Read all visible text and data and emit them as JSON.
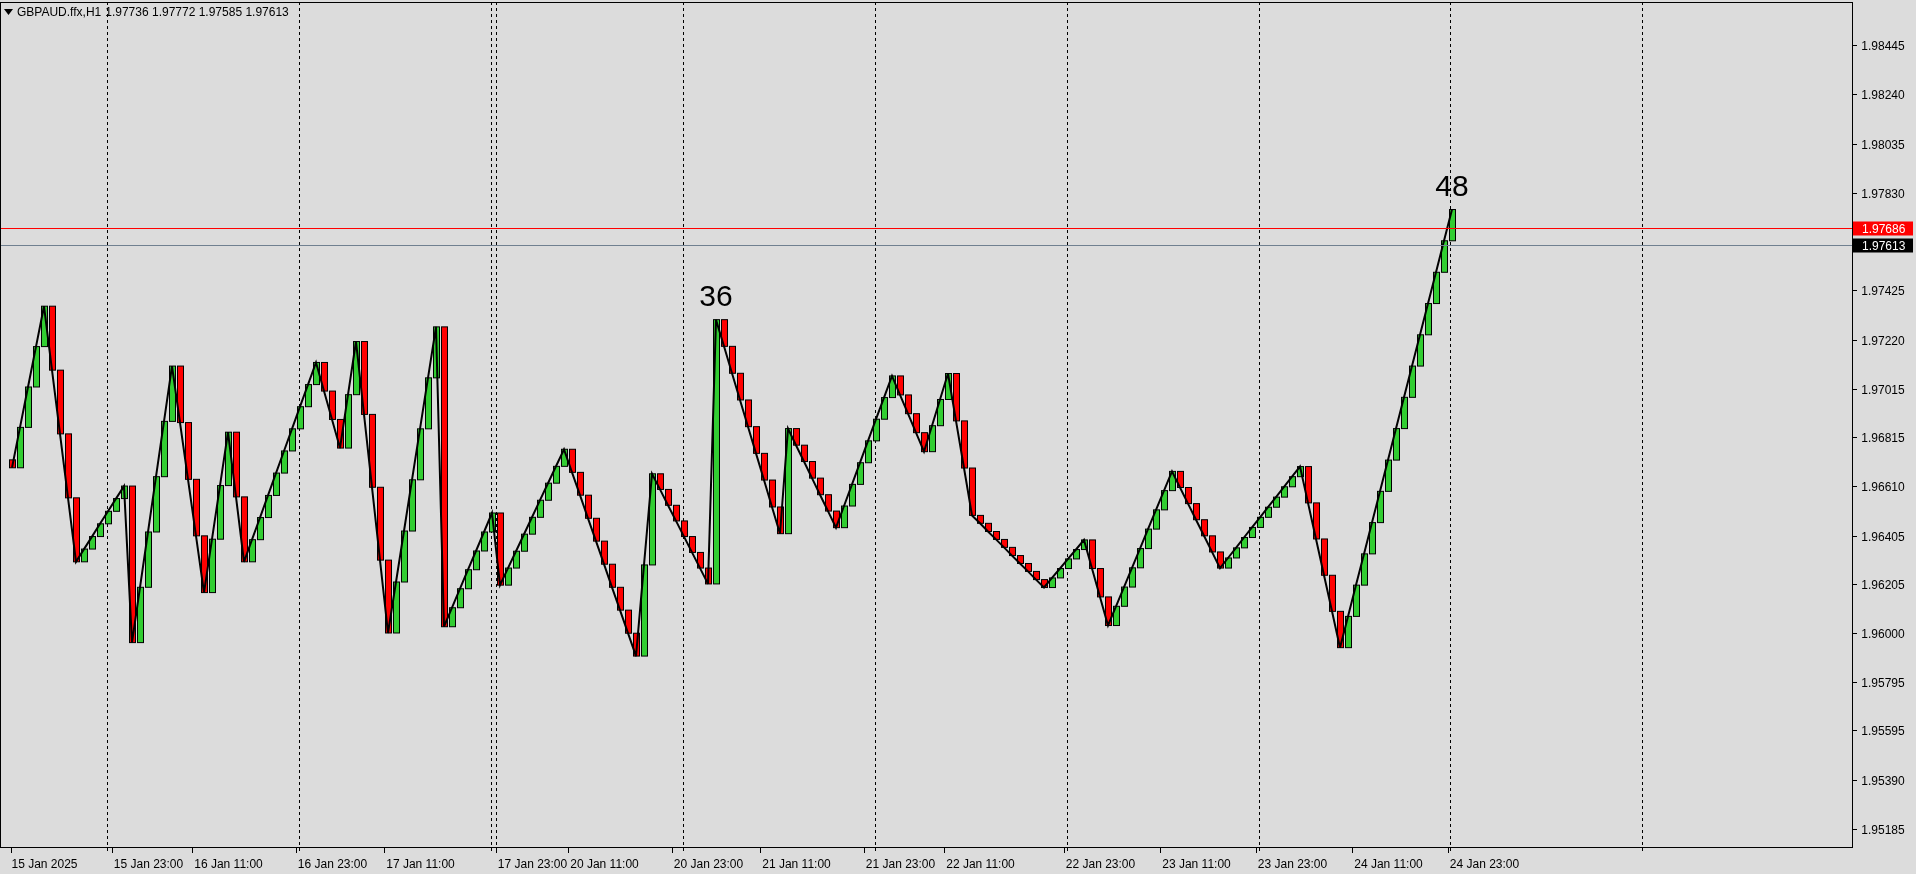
{
  "chart": {
    "symbol": "GBPAUD.ffx,H1",
    "ohlc": "1.97736 1.97772 1.97585 1.97613",
    "chart_data": {
      "type": "candlestick",
      "ylim": [
        1.9511,
        1.98624
      ],
      "categories": [
        null,
        null,
        null,
        null,
        null,
        "15 Jan 2025",
        null,
        null,
        null,
        null,
        null,
        null,
        null,
        null,
        null,
        null,
        null,
        null,
        "15 Jan 23:00",
        null,
        null,
        null,
        null,
        null,
        null,
        null,
        null,
        null,
        "16 Jan 11:00",
        null,
        null,
        null,
        null,
        null,
        null,
        null,
        null,
        null,
        null,
        null,
        null,
        "16 Jan 23:00",
        null,
        null,
        null,
        null,
        null,
        null,
        null,
        null,
        null,
        null,
        "17 Jan 11:00",
        null,
        null,
        null,
        null,
        null,
        null,
        null,
        null,
        null,
        null,
        null,
        null,
        null,
        "17 Jan 23:00",
        null,
        null,
        null,
        null,
        null,
        null,
        null,
        null,
        "20 Jan 11:00",
        null,
        null,
        null,
        null,
        null,
        null,
        null,
        null,
        null,
        null,
        null,
        null,
        "20 Jan 23:00",
        null,
        null,
        null,
        null,
        null,
        null,
        null,
        null,
        null,
        null,
        "21 Jan 11:00",
        null,
        null,
        null,
        null,
        null,
        null,
        null,
        null,
        null,
        null,
        null,
        null,
        "21 Jan 23:00",
        null,
        null,
        null,
        null,
        null,
        null,
        null,
        null,
        null,
        "22 Jan 11:00",
        null,
        null,
        null,
        null,
        null,
        null,
        null,
        null,
        null,
        null,
        null,
        null,
        null,
        null,
        "22 Jan 23:00",
        null,
        null,
        null,
        null,
        null,
        null,
        null,
        null,
        null,
        null,
        null,
        "23 Jan 11:00",
        null,
        null,
        null,
        null,
        null,
        null,
        null,
        null,
        null,
        null,
        null,
        "23 Jan 23:00",
        null,
        null,
        null,
        null,
        null,
        null,
        null,
        null,
        null,
        null,
        null,
        "24 Jan 11:00",
        null,
        null,
        null,
        null,
        null,
        null,
        null,
        null,
        null,
        null,
        null,
        "24 Jan 23:00"
      ],
      "ohlc": [
        null,
        [
          1.9672,
          1.9672,
          1.96687,
          1.96687
        ],
        [
          1.96687,
          1.96855,
          1.96687,
          1.96855
        ],
        [
          1.96855,
          1.97023,
          1.96855,
          1.97023
        ],
        [
          1.97023,
          1.97191,
          1.97023,
          1.97191
        ],
        [
          1.97191,
          1.97359,
          1.97191,
          1.97359
        ],
        [
          1.97359,
          1.97359,
          1.97093,
          1.97093
        ],
        [
          1.97093,
          1.97093,
          1.96828,
          1.96828
        ],
        [
          1.96828,
          1.96828,
          1.96562,
          1.96562
        ],
        [
          1.96562,
          1.96562,
          1.96296,
          1.96296
        ],
        [
          1.96296,
          1.96349,
          1.96296,
          1.96349
        ],
        [
          1.96349,
          1.96401,
          1.96349,
          1.96401
        ],
        [
          1.96401,
          1.96454,
          1.96401,
          1.96454
        ],
        [
          1.96454,
          1.96506,
          1.96454,
          1.96506
        ],
        [
          1.96506,
          1.96559,
          1.96506,
          1.96559
        ],
        [
          1.96559,
          1.96611,
          1.96559,
          1.96611
        ],
        [
          1.96611,
          1.96611,
          1.9596,
          1.9596
        ],
        [
          1.9596,
          1.9619,
          1.9596,
          1.9619
        ],
        [
          1.9619,
          1.9642,
          1.9619,
          1.9642
        ],
        [
          1.9642,
          1.9665,
          1.9642,
          1.9665
        ],
        [
          1.9665,
          1.9688,
          1.9665,
          1.9688
        ],
        [
          1.9688,
          1.9711,
          1.9688,
          1.9711
        ],
        [
          1.9711,
          1.9711,
          1.96875,
          1.96875
        ],
        [
          1.96875,
          1.96875,
          1.96639,
          1.96639
        ],
        [
          1.96639,
          1.96639,
          1.96404,
          1.96404
        ],
        [
          1.96404,
          1.96404,
          1.96168,
          1.96168
        ],
        [
          1.96168,
          1.9639,
          1.96168,
          1.9639
        ],
        [
          1.9639,
          1.96613,
          1.9639,
          1.96613
        ],
        [
          1.96613,
          1.96835,
          1.96613,
          1.96835
        ],
        [
          1.96835,
          1.96835,
          1.96566,
          1.96566
        ],
        [
          1.96566,
          1.96566,
          1.96296,
          1.96296
        ],
        [
          1.96296,
          1.96388,
          1.96296,
          1.96388
        ],
        [
          1.96388,
          1.9648,
          1.96388,
          1.9648
        ],
        [
          1.9648,
          1.96572,
          1.9648,
          1.96572
        ],
        [
          1.96572,
          1.96665,
          1.96572,
          1.96665
        ],
        [
          1.96665,
          1.96757,
          1.96665,
          1.96757
        ],
        [
          1.96757,
          1.96849,
          1.96757,
          1.96849
        ],
        [
          1.96849,
          1.96941,
          1.96849,
          1.96941
        ],
        [
          1.96941,
          1.97033,
          1.96941,
          1.97033
        ],
        [
          1.97033,
          1.97125,
          1.97033,
          1.97125
        ],
        [
          1.97125,
          1.97125,
          1.97006,
          1.97006
        ],
        [
          1.97006,
          1.97006,
          1.96888,
          1.96888
        ],
        [
          1.96888,
          1.96888,
          1.96769,
          1.96769
        ],
        [
          1.96769,
          1.96991,
          1.96769,
          1.96991
        ],
        [
          1.96991,
          1.97212,
          1.96991,
          1.97212
        ],
        [
          1.97212,
          1.97212,
          1.96909,
          1.96909
        ],
        [
          1.96909,
          1.96909,
          1.96606,
          1.96606
        ],
        [
          1.96606,
          1.96606,
          1.96303,
          1.96303
        ],
        [
          1.96303,
          1.96303,
          1.96,
          1.96
        ],
        [
          1.96,
          1.96212,
          1.96,
          1.96212
        ],
        [
          1.96212,
          1.96424,
          1.96212,
          1.96424
        ],
        [
          1.96424,
          1.96637,
          1.96424,
          1.96637
        ],
        [
          1.96637,
          1.96849,
          1.96637,
          1.96849
        ],
        [
          1.96849,
          1.97061,
          1.96849,
          1.97061
        ],
        [
          1.97061,
          1.97273,
          1.97061,
          1.97273
        ],
        [
          1.97273,
          1.97273,
          1.96026,
          1.96026
        ],
        [
          1.96026,
          1.96105,
          1.96026,
          1.96105
        ],
        [
          1.96105,
          1.96184,
          1.96105,
          1.96184
        ],
        [
          1.96184,
          1.96263,
          1.96184,
          1.96263
        ],
        [
          1.96263,
          1.96341,
          1.96263,
          1.96341
        ],
        [
          1.96341,
          1.9642,
          1.96341,
          1.9642
        ],
        [
          1.9642,
          1.96499,
          1.9642,
          1.96499
        ],
        [
          1.96499,
          1.96499,
          1.96199,
          1.96199
        ],
        [
          1.96199,
          1.9627,
          1.96199,
          1.9627
        ],
        [
          1.9627,
          1.9634,
          1.9627,
          1.9634
        ],
        [
          1.9634,
          1.96411,
          1.9634,
          1.96411
        ],
        [
          1.96411,
          1.96481,
          1.96411,
          1.96481
        ],
        [
          1.96481,
          1.96552,
          1.96481,
          1.96552
        ],
        [
          1.96552,
          1.96623,
          1.96552,
          1.96623
        ],
        [
          1.96623,
          1.96693,
          1.96623,
          1.96693
        ],
        [
          1.96693,
          1.96764,
          1.96693,
          1.96764
        ],
        [
          1.96764,
          1.96764,
          1.96668,
          1.96668
        ],
        [
          1.96668,
          1.96668,
          1.96573,
          1.96573
        ],
        [
          1.96573,
          1.96573,
          1.96477,
          1.96477
        ],
        [
          1.96477,
          1.96477,
          1.96382,
          1.96382
        ],
        [
          1.96382,
          1.96382,
          1.96286,
          1.96286
        ],
        [
          1.96286,
          1.96286,
          1.9619,
          1.9619
        ],
        [
          1.9619,
          1.9619,
          1.96095,
          1.96095
        ],
        [
          1.96095,
          1.96095,
          1.95999,
          1.95999
        ],
        [
          1.95999,
          1.95999,
          1.95904,
          1.95904
        ],
        [
          1.95904,
          1.96283,
          1.95904,
          1.96283
        ],
        [
          1.96283,
          1.96662,
          1.96283,
          1.96662
        ],
        [
          1.96662,
          1.96662,
          1.96597,
          1.96597
        ],
        [
          1.96597,
          1.96597,
          1.96531,
          1.96531
        ],
        [
          1.96531,
          1.96531,
          1.96466,
          1.96466
        ],
        [
          1.96466,
          1.96466,
          1.96401,
          1.96401
        ],
        [
          1.96401,
          1.96401,
          1.96335,
          1.96335
        ],
        [
          1.96335,
          1.96335,
          1.9627,
          1.9627
        ],
        [
          1.9627,
          1.9627,
          1.96204,
          1.96204
        ],
        [
          1.96204,
          1.97303,
          1.96204,
          1.97303
        ],
        [
          1.97303,
          1.97303,
          1.97192,
          1.97192
        ],
        [
          1.97192,
          1.97192,
          1.9708,
          1.9708
        ],
        [
          1.9708,
          1.9708,
          1.96969,
          1.96969
        ],
        [
          1.96969,
          1.96969,
          1.96858,
          1.96858
        ],
        [
          1.96858,
          1.96858,
          1.96747,
          1.96747
        ],
        [
          1.96747,
          1.96747,
          1.96636,
          1.96636
        ],
        [
          1.96636,
          1.96636,
          1.96524,
          1.96524
        ],
        [
          1.96524,
          1.96524,
          1.96413,
          1.96413
        ],
        [
          1.96413,
          1.9685,
          1.96413,
          1.9685
        ],
        [
          1.9685,
          1.9685,
          1.96781,
          1.96781
        ],
        [
          1.96781,
          1.96781,
          1.96713,
          1.96713
        ],
        [
          1.96713,
          1.96713,
          1.96644,
          1.96644
        ],
        [
          1.96644,
          1.96644,
          1.96575,
          1.96575
        ],
        [
          1.96575,
          1.96575,
          1.96507,
          1.96507
        ],
        [
          1.96507,
          1.96507,
          1.96438,
          1.96438
        ],
        [
          1.96438,
          1.96528,
          1.96438,
          1.96528
        ],
        [
          1.96528,
          1.96618,
          1.96528,
          1.96618
        ],
        [
          1.96618,
          1.96708,
          1.96618,
          1.96708
        ],
        [
          1.96708,
          1.96799,
          1.96708,
          1.96799
        ],
        [
          1.96799,
          1.96889,
          1.96799,
          1.96889
        ],
        [
          1.96889,
          1.96979,
          1.96889,
          1.96979
        ],
        [
          1.96979,
          1.97069,
          1.96979,
          1.97069
        ],
        [
          1.97069,
          1.97069,
          1.9699,
          1.9699
        ],
        [
          1.9699,
          1.9699,
          1.96912,
          1.96912
        ],
        [
          1.96912,
          1.96912,
          1.96833,
          1.96833
        ],
        [
          1.96833,
          1.96833,
          1.96754,
          1.96754
        ],
        [
          1.96754,
          1.96862,
          1.96754,
          1.96862
        ],
        [
          1.96862,
          1.96971,
          1.96862,
          1.96971
        ],
        [
          1.96971,
          1.97079,
          1.96971,
          1.97079
        ],
        [
          1.97079,
          1.97079,
          1.96882,
          1.96882
        ],
        [
          1.96882,
          1.96882,
          1.96686,
          1.96686
        ],
        [
          1.96686,
          1.96686,
          1.96489,
          1.96489
        ],
        [
          1.96489,
          1.96489,
          1.96456,
          1.96456
        ],
        [
          1.96456,
          1.96456,
          1.96422,
          1.96422
        ],
        [
          1.96422,
          1.96422,
          1.96389,
          1.96389
        ],
        [
          1.96389,
          1.96389,
          1.96356,
          1.96356
        ],
        [
          1.96356,
          1.96356,
          1.96322,
          1.96322
        ],
        [
          1.96322,
          1.96322,
          1.96289,
          1.96289
        ],
        [
          1.96289,
          1.96289,
          1.96256,
          1.96256
        ],
        [
          1.96256,
          1.96256,
          1.96222,
          1.96222
        ],
        [
          1.96222,
          1.96222,
          1.96189,
          1.96189
        ],
        [
          1.96189,
          1.96229,
          1.96189,
          1.96229
        ],
        [
          1.96229,
          1.96268,
          1.96229,
          1.96268
        ],
        [
          1.96268,
          1.96308,
          1.96268,
          1.96308
        ],
        [
          1.96308,
          1.96347,
          1.96308,
          1.96347
        ],
        [
          1.96347,
          1.96387,
          1.96347,
          1.96387
        ],
        [
          1.96387,
          1.96387,
          1.96268,
          1.96268
        ],
        [
          1.96268,
          1.96268,
          1.9615,
          1.9615
        ],
        [
          1.9615,
          1.9615,
          1.96031,
          1.96031
        ],
        [
          1.96031,
          1.96111,
          1.96031,
          1.96111
        ],
        [
          1.96111,
          1.96191,
          1.96111,
          1.96191
        ],
        [
          1.96191,
          1.96271,
          1.96191,
          1.96271
        ],
        [
          1.96271,
          1.96351,
          1.96271,
          1.96351
        ],
        [
          1.96351,
          1.96432,
          1.96351,
          1.96432
        ],
        [
          1.96432,
          1.96512,
          1.96432,
          1.96512
        ],
        [
          1.96512,
          1.96592,
          1.96512,
          1.96592
        ],
        [
          1.96592,
          1.96672,
          1.96592,
          1.96672
        ],
        [
          1.96672,
          1.96672,
          1.96605,
          1.96605
        ],
        [
          1.96605,
          1.96605,
          1.96538,
          1.96538
        ],
        [
          1.96538,
          1.96538,
          1.96471,
          1.96471
        ],
        [
          1.96471,
          1.96471,
          1.96404,
          1.96404
        ],
        [
          1.96404,
          1.96404,
          1.96337,
          1.96337
        ],
        [
          1.96337,
          1.96337,
          1.9627,
          1.9627
        ],
        [
          1.9627,
          1.96312,
          1.9627,
          1.96312
        ],
        [
          1.96312,
          1.96354,
          1.96312,
          1.96354
        ],
        [
          1.96354,
          1.96397,
          1.96354,
          1.96397
        ],
        [
          1.96397,
          1.96439,
          1.96397,
          1.96439
        ],
        [
          1.96439,
          1.96481,
          1.96439,
          1.96481
        ],
        [
          1.96481,
          1.96523,
          1.96481,
          1.96523
        ],
        [
          1.96523,
          1.96565,
          1.96523,
          1.96565
        ],
        [
          1.96565,
          1.96608,
          1.96565,
          1.96608
        ],
        [
          1.96608,
          1.9665,
          1.96608,
          1.9665
        ],
        [
          1.9665,
          1.96692,
          1.9665,
          1.96692
        ],
        [
          1.96692,
          1.96692,
          1.96541,
          1.96541
        ],
        [
          1.96541,
          1.96541,
          1.96391,
          1.96391
        ],
        [
          1.96391,
          1.96391,
          1.9624,
          1.9624
        ],
        [
          1.9624,
          1.9624,
          1.9609,
          1.9609
        ],
        [
          1.9609,
          1.9609,
          1.95939,
          1.95939
        ],
        [
          1.95939,
          1.96069,
          1.95939,
          1.96069
        ],
        [
          1.96069,
          1.96199,
          1.96069,
          1.96199
        ],
        [
          1.96199,
          1.96329,
          1.96199,
          1.96329
        ],
        [
          1.96329,
          1.96459,
          1.96329,
          1.96459
        ],
        [
          1.96459,
          1.96589,
          1.96459,
          1.96589
        ],
        [
          1.96589,
          1.96719,
          1.96589,
          1.96719
        ],
        [
          1.96719,
          1.9685,
          1.96719,
          1.9685
        ],
        [
          1.9685,
          1.9698,
          1.9685,
          1.9698
        ],
        [
          1.9698,
          1.9711,
          1.9698,
          1.9711
        ],
        [
          1.9711,
          1.9724,
          1.9711,
          1.9724
        ],
        [
          1.9724,
          1.9737,
          1.9724,
          1.9737
        ],
        [
          1.9737,
          1.975,
          1.9737,
          1.975
        ],
        [
          1.975,
          1.97631,
          1.975,
          1.97631
        ],
        [
          1.97631,
          1.97761,
          1.97631,
          1.97761
        ],
        null,
        null,
        null,
        null
      ],
      "series": [
        {
          "type": "line",
          "color": "#000000",
          "values": [
            null,
            1.96687,
            1.96855,
            1.97023,
            1.97191,
            1.97359,
            1.97093,
            1.96828,
            1.96562,
            1.96296,
            1.96349,
            1.96401,
            1.96454,
            1.96506,
            1.96559,
            1.96611,
            1.9596,
            1.9619,
            1.9642,
            1.9665,
            1.9688,
            1.9711,
            1.96875,
            1.96639,
            1.96404,
            1.96168,
            1.9639,
            1.96613,
            1.96835,
            1.96566,
            1.96296,
            1.96388,
            1.9648,
            1.96572,
            1.96665,
            1.96757,
            1.96849,
            1.96941,
            1.97033,
            1.97125,
            1.97006,
            1.96888,
            1.96769,
            1.96991,
            1.97212,
            1.96909,
            1.96606,
            1.96303,
            1.96,
            1.96212,
            1.96424,
            1.96637,
            1.96849,
            1.97061,
            1.97273,
            1.96026,
            1.96105,
            1.96184,
            1.96263,
            1.96341,
            1.9642,
            1.96499,
            1.96199,
            1.9627,
            1.9634,
            1.96411,
            1.96481,
            1.96552,
            1.96623,
            1.96693,
            1.96764,
            1.96668,
            1.96573,
            1.96477,
            1.96382,
            1.96286,
            1.9619,
            1.96095,
            1.95999,
            1.95904,
            1.96283,
            1.96662,
            1.96597,
            1.96531,
            1.96466,
            1.96401,
            1.96335,
            1.9627,
            1.96204,
            1.97303,
            1.97192,
            1.9708,
            1.96969,
            1.96858,
            1.96747,
            1.96636,
            1.96524,
            1.96413,
            1.9685,
            1.96781,
            1.96713,
            1.96644,
            1.96575,
            1.96507,
            1.96438,
            1.96528,
            1.96618,
            1.96708,
            1.96799,
            1.96889,
            1.96979,
            1.97069,
            1.9699,
            1.96912,
            1.96833,
            1.96754,
            1.96862,
            1.96971,
            1.97079,
            1.96882,
            1.96686,
            1.96489,
            1.96456,
            1.96422,
            1.96389,
            1.96356,
            1.96322,
            1.96289,
            1.96256,
            1.96222,
            1.96189,
            1.96229,
            1.96268,
            1.96308,
            1.96347,
            1.96387,
            1.96268,
            1.9615,
            1.96031,
            1.96111,
            1.96191,
            1.96271,
            1.96351,
            1.96432,
            1.96512,
            1.96592,
            1.96672,
            1.96605,
            1.96538,
            1.96471,
            1.96404,
            1.96337,
            1.9627,
            1.96312,
            1.96354,
            1.96397,
            1.96439,
            1.96481,
            1.96523,
            1.96565,
            1.96608,
            1.9665,
            1.96692,
            1.96541,
            1.96391,
            1.9624,
            1.9609,
            1.95939,
            1.96069,
            1.96199,
            1.96329,
            1.96459,
            1.96589,
            1.96719,
            1.9685,
            1.9698,
            1.9711,
            1.9724,
            1.9737,
            1.975,
            1.97631,
            1.97761,
            null,
            null,
            null,
            null
          ]
        }
      ],
      "yticks": [
        {
          "value": 1.98445,
          "label": "1.98445"
        },
        {
          "value": 1.9824,
          "label": "1.98240"
        },
        {
          "value": 1.98035,
          "label": "1.98035"
        },
        {
          "value": 1.9783,
          "label": "1.97830"
        },
        {
          "value": 1.97425,
          "label": "1.97425"
        },
        {
          "value": 1.9722,
          "label": "1.97220"
        },
        {
          "value": 1.97015,
          "label": "1.97015"
        },
        {
          "value": 1.96815,
          "label": "1.96815"
        },
        {
          "value": 1.9661,
          "label": "1.96610"
        },
        {
          "value": 1.96405,
          "label": "1.96405"
        },
        {
          "value": 1.96205,
          "label": "1.96205"
        },
        {
          "value": 1.96,
          "label": "1.96000"
        },
        {
          "value": 1.95795,
          "label": "1.95795"
        },
        {
          "value": 1.95595,
          "label": "1.95595"
        },
        {
          "value": 1.9539,
          "label": "1.95390"
        },
        {
          "value": 1.95185,
          "label": "1.95185"
        }
      ],
      "ref_lines": [
        {
          "axis": "y",
          "value": 1.97686,
          "label": "1.97686",
          "color": "#ff0000"
        },
        {
          "axis": "y",
          "value": 1.97613,
          "label": "1.97613",
          "color": "#708090"
        }
      ],
      "annotations": [
        {
          "y": 1.97303,
          "text": "36"
        },
        {
          "y": 1.97761,
          "text": "48"
        }
      ]
    }
  }
}
